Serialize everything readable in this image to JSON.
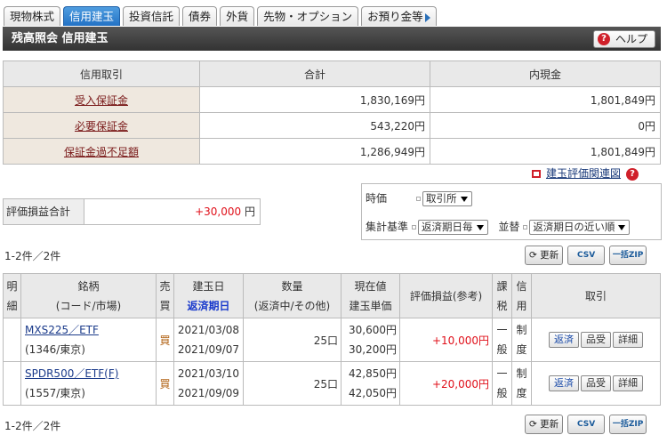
{
  "tabs": [
    "現物株式",
    "信用建玉",
    "投資信託",
    "債券",
    "外貨",
    "先物・オプション",
    "お預り金等"
  ],
  "title": "残高照会 信用建玉",
  "help": "ヘルプ",
  "summary": {
    "headers": [
      "信用取引",
      "合計",
      "内現金"
    ],
    "rows": [
      {
        "label": "受入保証金",
        "total": "1,830,169円",
        "cash": "1,801,849円"
      },
      {
        "label": "必要保証金",
        "total": "543,220円",
        "cash": "0円"
      },
      {
        "label": "保証金過不足額",
        "total": "1,286,949円",
        "cash": "1,801,849円"
      }
    ]
  },
  "related_link": "建玉評価関連図",
  "pl_total": {
    "label": "評価損益合計",
    "value": "+30,000",
    "unit": "円"
  },
  "filters": {
    "time_label": "時価",
    "time_value": "取引所",
    "agg_label": "集計基準",
    "agg_value": "返済期日毎",
    "sort_label": "並替",
    "sort_value": "返済期日の近い順"
  },
  "count": "1-2件／2件",
  "tools": {
    "refresh": "更新",
    "csv": "CSV",
    "zip": "一括ZIP"
  },
  "positions": {
    "headers": {
      "detail": "明細",
      "name": "銘柄",
      "code": "(コード/市場)",
      "side": "売買",
      "date": "建玉日",
      "due": "返済期日",
      "qty": "数量",
      "qty_sub": "(返済中/その他)",
      "price": "現在値",
      "price_sub": "建玉単価",
      "pl": "評価損益(参考)",
      "tax": "課税",
      "credit": "信用",
      "action": "取引"
    },
    "rows": [
      {
        "name": "MXS225／ETF",
        "code": "(1346/東京)",
        "side": "買",
        "date": "2021/03/08",
        "due": "2021/09/07",
        "qty": "25口",
        "price": "30,600円",
        "cost": "30,200円",
        "pl": "+10,000円",
        "tax": "一般",
        "credit": "制度"
      },
      {
        "name": "SPDR500／ETF(F)",
        "code": "(1557/東京)",
        "side": "買",
        "date": "2021/03/10",
        "due": "2021/09/09",
        "qty": "25口",
        "price": "42,850円",
        "cost": "42,050円",
        "pl": "+20,000円",
        "tax": "一般",
        "credit": "制度"
      }
    ],
    "actions": [
      "返済",
      "品受",
      "詳細"
    ]
  },
  "colors": {
    "accent": "#2372c5",
    "profit": "#e0101a",
    "title_bg": "#444444"
  }
}
